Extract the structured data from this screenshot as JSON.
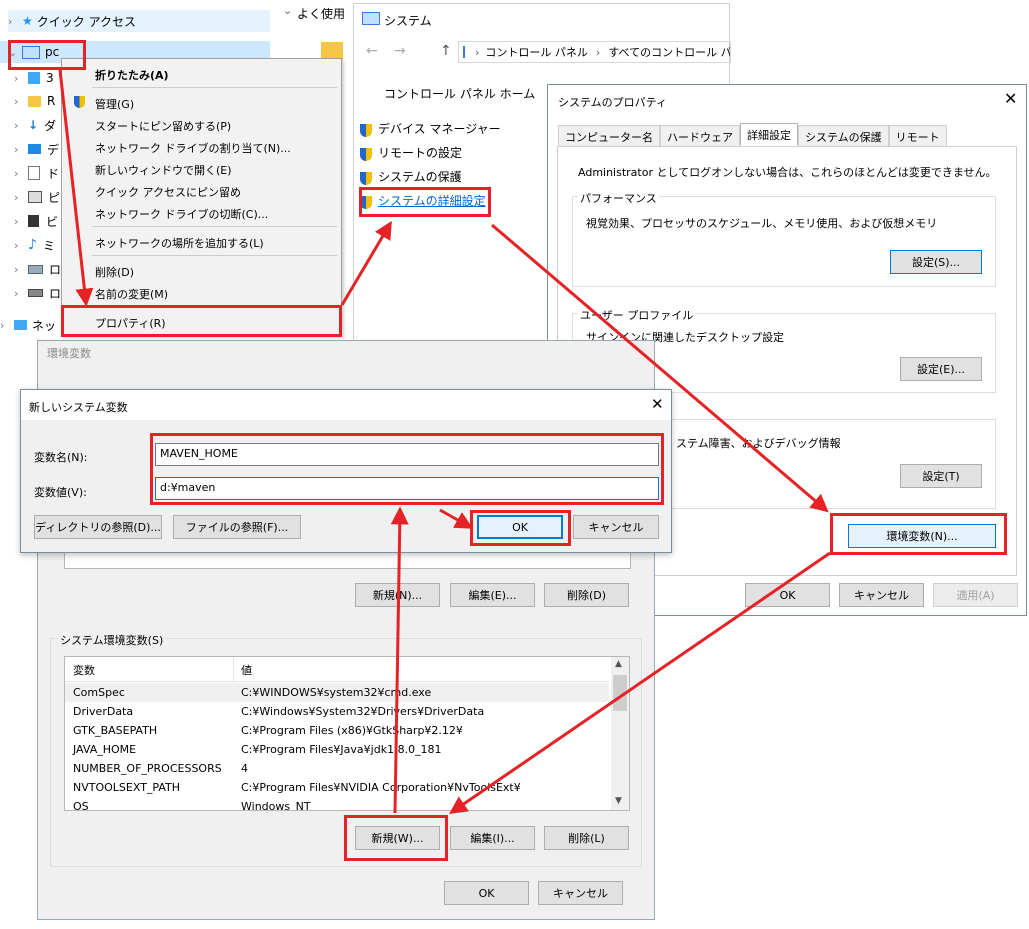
{
  "explorer": {
    "nav": [
      {
        "label": "クイック アクセス"
      },
      {
        "label": "pc"
      },
      {
        "label": "3"
      },
      {
        "label": "R"
      },
      {
        "label": "ダ"
      },
      {
        "label": "デ"
      },
      {
        "label": "ド"
      },
      {
        "label": "ピ"
      },
      {
        "label": "ビ"
      },
      {
        "label": "ミ"
      },
      {
        "label": "ロ"
      },
      {
        "label": "ロ"
      },
      {
        "label": "ネッ"
      }
    ],
    "quick_access_header": "よく使用"
  },
  "context_menu": {
    "items": [
      {
        "label": "折りたたみ(A)",
        "bold": true
      },
      {
        "label": "管理(G)"
      },
      {
        "label": "スタートにピン留めする(P)"
      },
      {
        "label": "ネットワーク ドライブの割り当て(N)..."
      },
      {
        "label": "新しいウィンドウで開く(E)"
      },
      {
        "label": "クイック アクセスにピン留め"
      },
      {
        "label": "ネットワーク ドライブの切断(C)..."
      },
      {
        "label": "ネットワークの場所を追加する(L)"
      },
      {
        "label": "削除(D)"
      },
      {
        "label": "名前の変更(M)"
      },
      {
        "label": "プロパティ(R)"
      }
    ]
  },
  "system_window": {
    "title": "システム",
    "breadcrumb": [
      "コントロール パネル",
      "すべてのコントロール パネル"
    ],
    "home_link": "コントロール パネル ホーム",
    "links": [
      "デバイス マネージャー",
      "リモートの設定",
      "システムの保護",
      "システムの詳細設定"
    ]
  },
  "sys_props": {
    "title": "システムのプロパティ",
    "tabs": [
      "コンピューター名",
      "ハードウェア",
      "詳細設定",
      "システムの保護",
      "リモート"
    ],
    "active_tab": 2,
    "admin_note": "Administrator としてログオンしない場合は、これらのほとんどは変更できません。",
    "perf_title": "パフォーマンス",
    "perf_desc": "視覚効果、プロセッサのスケジュール、メモリ使用、および仮想メモリ",
    "perf_btn": "設定(S)...",
    "profile_title": "ユーザー プロファイル",
    "profile_desc": "サインインに関連したデスクトップ設定",
    "profile_btn": "設定(E)...",
    "startup_desc": "ステム障害、およびデバッグ情報",
    "startup_btn": "設定(T)",
    "env_btn": "環境変数(N)...",
    "ok": "OK",
    "cancel": "キャンセル",
    "apply": "適用(A)"
  },
  "env_window": {
    "title": "環境変数",
    "user_new": "新規(N)...",
    "user_edit": "編集(E)...",
    "user_delete": "削除(D)",
    "sys_group": "システム環境変数(S)",
    "col_var": "変数",
    "col_val": "値",
    "rows": [
      {
        "name": "ComSpec",
        "value": "C:¥WINDOWS¥system32¥cmd.exe"
      },
      {
        "name": "DriverData",
        "value": "C:¥Windows¥System32¥Drivers¥DriverData"
      },
      {
        "name": "GTK_BASEPATH",
        "value": "C:¥Program Files (x86)¥GtkSharp¥2.12¥"
      },
      {
        "name": "JAVA_HOME",
        "value": "C:¥Program Files¥Java¥jdk1.8.0_181"
      },
      {
        "name": "NUMBER_OF_PROCESSORS",
        "value": "4"
      },
      {
        "name": "NVTOOLSEXT_PATH",
        "value": "C:¥Program Files¥NVIDIA Corporation¥NvToolsExt¥"
      },
      {
        "name": "OS",
        "value": "Windows_NT"
      }
    ],
    "sys_new": "新規(W)...",
    "sys_edit": "編集(I)...",
    "sys_delete": "削除(L)",
    "ok": "OK",
    "cancel": "キャンセル"
  },
  "new_var_dialog": {
    "title": "新しいシステム変数",
    "name_label": "変数名(N):",
    "name_value": "MAVEN_HOME",
    "value_label": "変数値(V):",
    "value_value": "d:¥maven",
    "browse_dir": "ディレクトリの参照(D)...",
    "browse_file": "ファイルの参照(F)...",
    "ok": "OK",
    "cancel": "キャンセル"
  },
  "colors": {
    "highlight": "#e52225",
    "selection": "#cce8ff",
    "link": "#0066cc",
    "accent": "#0078d7"
  }
}
